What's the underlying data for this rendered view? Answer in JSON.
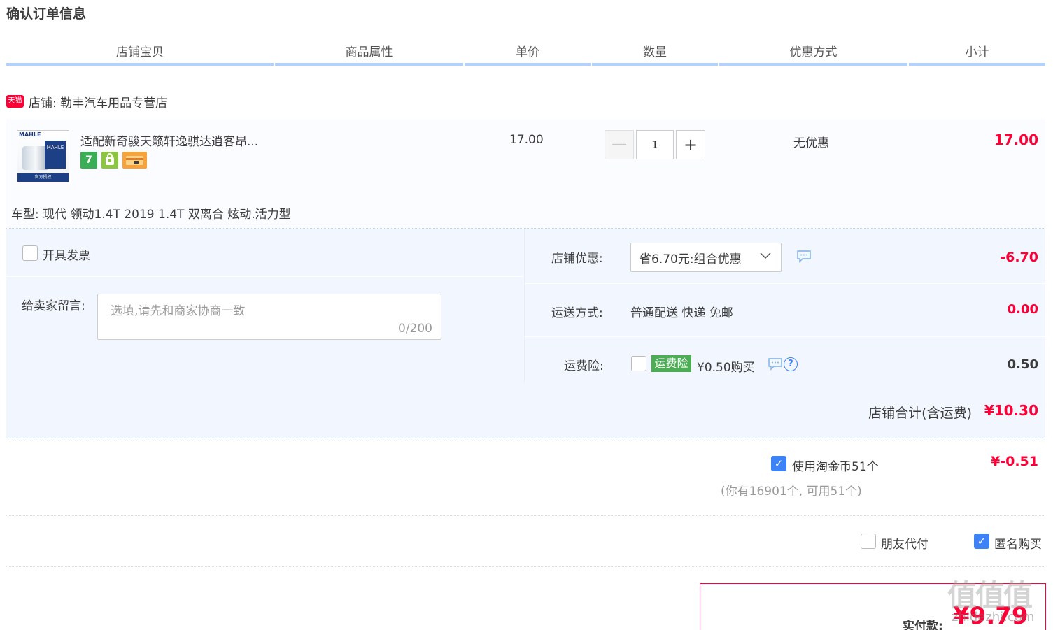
{
  "page": {
    "title": "确认订单信息"
  },
  "table_header": {
    "columns": [
      "店铺宝贝",
      "商品属性",
      "单价",
      "数量",
      "优惠方式",
      "小计"
    ]
  },
  "shop": {
    "badge": "天猫",
    "name_label": "店铺: 勒丰汽车用品专营店"
  },
  "item": {
    "thumb_brand": "MAHLE",
    "thumb_footer": "官方授权",
    "title": "适配新奇骏天籁轩逸骐达逍客昂...",
    "service_icons": [
      "7-day-return-icon",
      "guarantee-icon",
      "credit-card-icon"
    ],
    "unit_price": "17.00",
    "quantity": "1",
    "qty_minus": "—",
    "qty_plus": "+",
    "discount": "无优惠",
    "subtotal": "17.00",
    "car_model": "车型: 现代 领动1.4T 2019 1.4T 双离合 炫动.活力型"
  },
  "options": {
    "invoice_label": "开具发票",
    "message_label": "给卖家留言:",
    "message_placeholder": "选填,请先和商家协商一致",
    "message_count": "0/200",
    "shop_discount_label": "店铺优惠:",
    "shop_discount_select": "省6.70元:组合优惠",
    "shop_discount_amount": "-6.70",
    "shipping_label": "运送方式:",
    "shipping_value": "普通配送 快递 免邮",
    "shipping_amount": "0.00",
    "insurance_label": "运费险:",
    "insurance_tag": "运费险",
    "insurance_price": "¥0.50购买",
    "insurance_amount": "0.50"
  },
  "shop_total": {
    "label": "店铺合计(含运费)",
    "amount": "¥10.30"
  },
  "coins": {
    "label": "使用淘金币51个",
    "checked": true,
    "amount": "¥-0.51",
    "note": "(你有16901个, 可用51个)"
  },
  "extras": {
    "friend_pay_label": "朋友代付",
    "friend_pay_checked": false,
    "anonymous_label": "匿名购买",
    "anonymous_checked": true
  },
  "payment": {
    "label": "实付款:",
    "amount": "¥9.79"
  },
  "watermark": {
    "logo": "值值值",
    "text": "zhidezhi.com"
  },
  "colors": {
    "accent_red": "#ff0036",
    "header_line": "#b2d1ff",
    "panel_bg": "#f2f7ff",
    "checkbox_blue": "#3d82f7",
    "insurance_green": "#4cad55"
  }
}
